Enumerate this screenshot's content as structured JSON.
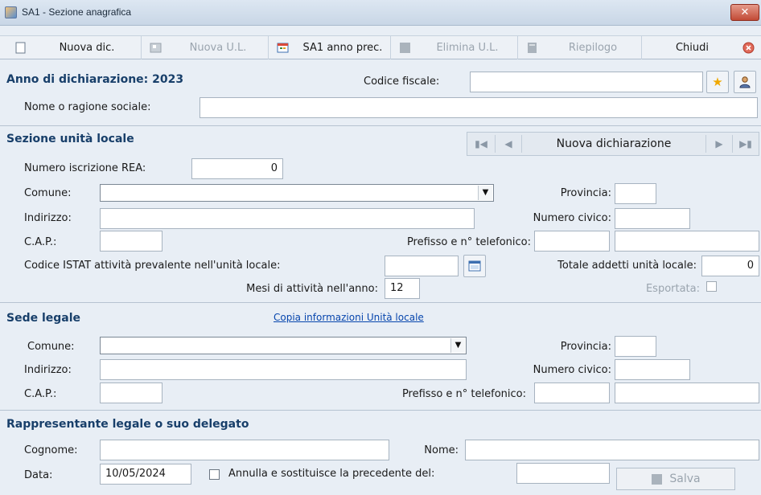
{
  "window": {
    "title": "SA1 - Sezione anagrafica",
    "close_glyph": "✕"
  },
  "toolbar": {
    "items": [
      {
        "label": "Nuova dic.",
        "icon": "new-document-icon",
        "enabled": true
      },
      {
        "label": "Nuova U.L.",
        "icon": "new-unit-icon",
        "enabled": false
      },
      {
        "label": "SA1 anno prec.",
        "icon": "calendar-icon",
        "enabled": true
      },
      {
        "label": "Elimina U.L.",
        "icon": "delete-icon",
        "enabled": false
      },
      {
        "label": "Riepilogo",
        "icon": "summary-icon",
        "enabled": false
      },
      {
        "label": "Chiudi",
        "icon": "close-circle-icon",
        "enabled": true
      }
    ]
  },
  "header": {
    "anno_label": "Anno di dichiarazione: 2023",
    "codice_fiscale_label": "Codice fiscale:",
    "codice_fiscale_value": "",
    "nome_label": "Nome o ragione sociale:",
    "nome_value": ""
  },
  "unita_locale": {
    "title": "Sezione unità locale",
    "nav_label": "Nuova dichiarazione",
    "rea_label": "Numero iscrizione REA:",
    "rea_value": "0",
    "comune_label": "Comune:",
    "comune_value": "",
    "provincia_label": "Provincia:",
    "provincia_value": "",
    "indirizzo_label": "Indirizzo:",
    "indirizzo_value": "",
    "civico_label": "Numero civico:",
    "civico_value": "",
    "cap_label": "C.A.P.:",
    "cap_value": "",
    "telefono_label": "Prefisso e n° telefonico:",
    "prefisso_value": "",
    "telefono_value": "",
    "istat_label": "Codice ISTAT attività prevalente nell'unità locale:",
    "istat_value": "",
    "addetti_label": "Totale addetti unità locale:",
    "addetti_value": "0",
    "mesi_label": "Mesi di attività nell'anno:",
    "mesi_value": "12",
    "esportata_label": "Esportata:"
  },
  "sede_legale": {
    "title": "Sede legale",
    "copy_link": "Copia informazioni Unità locale",
    "comune_label": "Comune:",
    "comune_value": "",
    "provincia_label": "Provincia:",
    "provincia_value": "",
    "indirizzo_label": "Indirizzo:",
    "indirizzo_value": "",
    "civico_label": "Numero civico:",
    "civico_value": "",
    "cap_label": "C.A.P.:",
    "cap_value": "",
    "telefono_label": "Prefisso e n° telefonico:",
    "prefisso_value": "",
    "telefono_value": ""
  },
  "rappresentante": {
    "title": "Rappresentante legale o suo delegato",
    "cognome_label": "Cognome:",
    "cognome_value": "",
    "nome_label": "Nome:",
    "nome_value": "",
    "data_label": "Data:",
    "data_value": "10/05/2024",
    "annulla_label": "Annulla e sostituisce la precedente del:",
    "annulla_value": "",
    "save_label": "Salva"
  },
  "colors": {
    "section_title": "#183f6a",
    "background": "#e8eef5",
    "disabled_text": "#9aa4ae"
  }
}
